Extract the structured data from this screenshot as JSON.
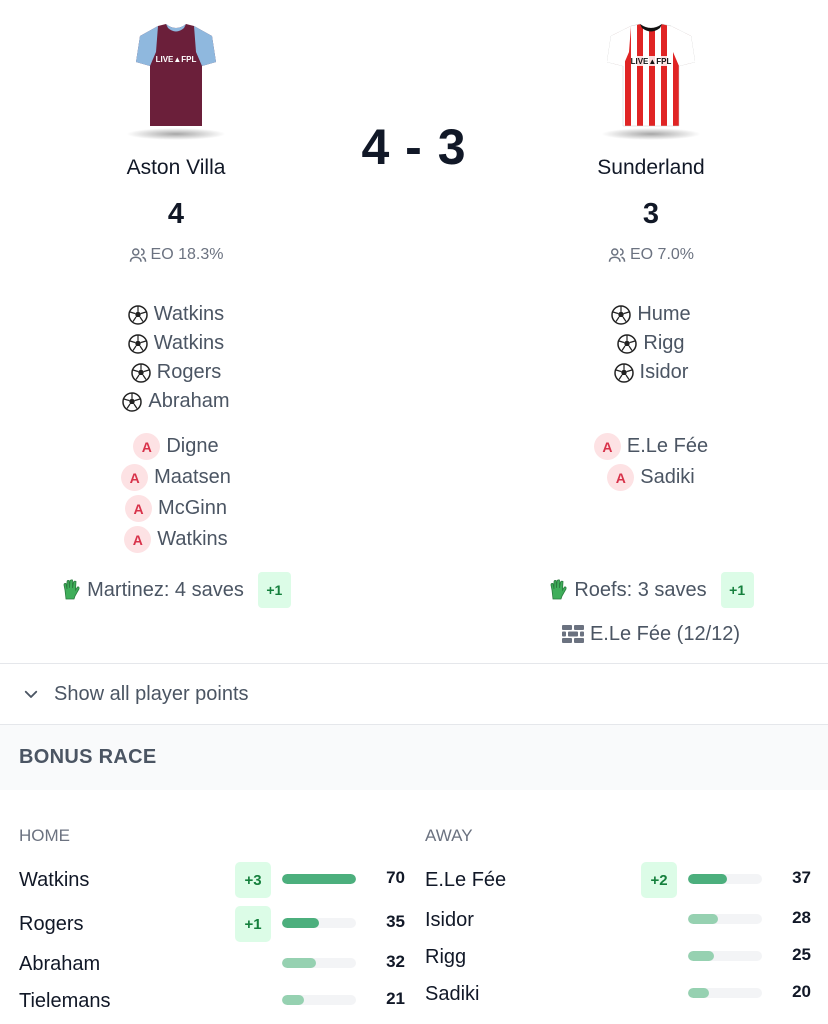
{
  "match": {
    "scoreline": "4 - 3",
    "home": {
      "name": "Aston Villa",
      "score": "4",
      "eo": "EO 18.3%",
      "shirt_sponsor": "LIVE▲FPL",
      "shirt_colors": {
        "body": "#6b1f3a",
        "sleeves": "#8fb8de"
      },
      "goals": [
        "Watkins",
        "Watkins",
        "Rogers",
        "Abraham"
      ],
      "assists": [
        "Digne",
        "Maatsen",
        "McGinn",
        "Watkins"
      ],
      "saves": {
        "text": "Martinez: 4 saves",
        "bonus": "+1"
      }
    },
    "away": {
      "name": "Sunderland",
      "score": "3",
      "eo": "EO 7.0%",
      "shirt_sponsor": "LIVE▲FPL",
      "shirt_colors": {
        "body": "#ffffff",
        "stripes": "#e02424"
      },
      "goals": [
        "Hume",
        "Rigg",
        "Isidor"
      ],
      "assists": [
        "E.Le Fée",
        "Sadiki"
      ],
      "saves": {
        "text": "Roefs: 3 saves",
        "bonus": "+1"
      },
      "defcon": "E.Le Fée (12/12)"
    }
  },
  "show_all": {
    "label": "Show all player points",
    "icon": "chevron-down-icon"
  },
  "bonus_race": {
    "title": "BONUS RACE",
    "max": 70,
    "home": {
      "label": "HOME",
      "players": [
        {
          "name": "Watkins",
          "bonus": "+3",
          "bps": 70
        },
        {
          "name": "Rogers",
          "bonus": "+1",
          "bps": 35
        },
        {
          "name": "Abraham",
          "bonus": null,
          "bps": 32
        },
        {
          "name": "Tielemans",
          "bonus": null,
          "bps": 21
        }
      ]
    },
    "away": {
      "label": "AWAY",
      "players": [
        {
          "name": "E.Le Fée",
          "bonus": "+2",
          "bps": 37
        },
        {
          "name": "Isidor",
          "bonus": null,
          "bps": 28
        },
        {
          "name": "Rigg",
          "bonus": null,
          "bps": 25
        },
        {
          "name": "Sadiki",
          "bonus": null,
          "bps": 20
        }
      ]
    }
  },
  "colors": {
    "bar_strong": "#4caf7d",
    "bar_light": "#96d1b1",
    "assist_bg": "#fde2e4",
    "assist_fg": "#d8324a",
    "bonus_bg": "#dcfce7",
    "bonus_fg": "#15803d"
  }
}
